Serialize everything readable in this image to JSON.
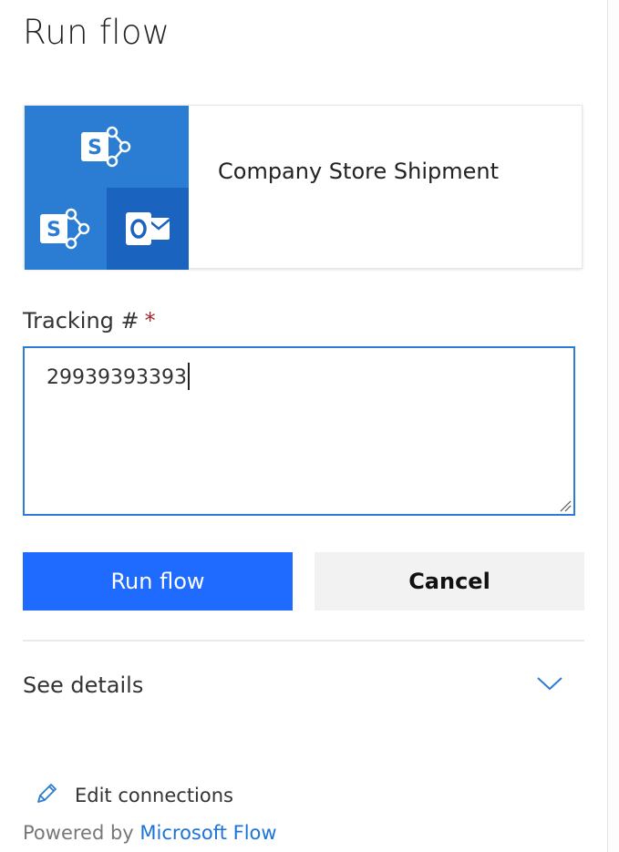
{
  "panel": {
    "title": "Run flow"
  },
  "flow_card": {
    "name": "Company Store Shipment",
    "icons": [
      "sharepoint-icon",
      "sharepoint-icon",
      "outlook-icon"
    ],
    "tile_color": "#2b7cd3"
  },
  "form": {
    "field_label": "Tracking #",
    "required_marker": "*",
    "field_value": "29939393393"
  },
  "actions": {
    "run_label": "Run flow",
    "cancel_label": "Cancel",
    "run_color": "#1f6bff"
  },
  "details": {
    "label": "See details"
  },
  "footer": {
    "edit_connections": "Edit connections",
    "powered_by": "Powered by",
    "brand": "Microsoft Flow"
  }
}
